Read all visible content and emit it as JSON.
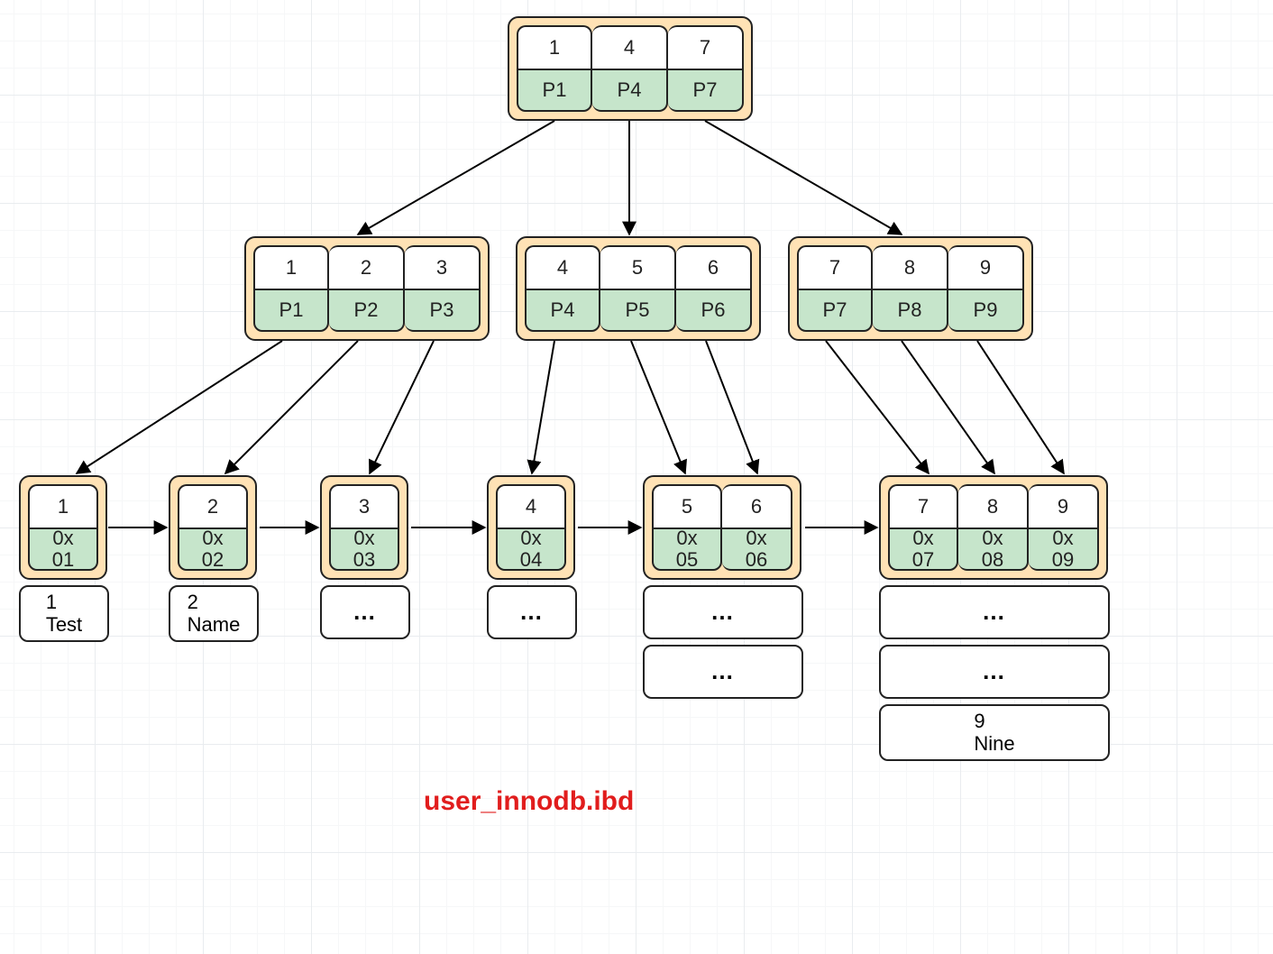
{
  "caption": "user_innodb.ibd",
  "root": {
    "cols": [
      {
        "key": "1",
        "ptr": "P1"
      },
      {
        "key": "4",
        "ptr": "P4"
      },
      {
        "key": "7",
        "ptr": "P7"
      }
    ]
  },
  "mids": [
    {
      "cols": [
        {
          "key": "1",
          "ptr": "P1"
        },
        {
          "key": "2",
          "ptr": "P2"
        },
        {
          "key": "3",
          "ptr": "P3"
        }
      ]
    },
    {
      "cols": [
        {
          "key": "4",
          "ptr": "P4"
        },
        {
          "key": "5",
          "ptr": "P5"
        },
        {
          "key": "6",
          "ptr": "P6"
        }
      ]
    },
    {
      "cols": [
        {
          "key": "7",
          "ptr": "P7"
        },
        {
          "key": "8",
          "ptr": "P8"
        },
        {
          "key": "9",
          "ptr": "P9"
        }
      ]
    }
  ],
  "leaves": [
    {
      "wrap_w": 100,
      "cols": [
        {
          "key": "1",
          "val": "0x\n01"
        }
      ],
      "rows": [
        {
          "text": "1\nTest"
        }
      ]
    },
    {
      "wrap_w": 100,
      "cols": [
        {
          "key": "2",
          "val": "0x\n02"
        }
      ],
      "rows": [
        {
          "text": "2\nName"
        }
      ]
    },
    {
      "wrap_w": 100,
      "cols": [
        {
          "key": "3",
          "val": "0x\n03"
        }
      ],
      "rows": [
        {
          "text": "…",
          "ell": true
        }
      ]
    },
    {
      "wrap_w": 100,
      "cols": [
        {
          "key": "4",
          "val": "0x\n04"
        }
      ],
      "rows": [
        {
          "text": "…",
          "ell": true
        }
      ]
    },
    {
      "wrap_w": 178,
      "cols": [
        {
          "key": "5",
          "val": "0x\n05"
        },
        {
          "key": "6",
          "val": "0x\n06"
        }
      ],
      "rows": [
        {
          "text": "…",
          "ell": true
        },
        {
          "text": "…",
          "ell": true
        }
      ]
    },
    {
      "wrap_w": 256,
      "cols": [
        {
          "key": "7",
          "val": "0x\n07"
        },
        {
          "key": "8",
          "val": "0x\n08"
        },
        {
          "key": "9",
          "val": "0x\n09"
        }
      ],
      "rows": [
        {
          "text": "…",
          "ell": true
        },
        {
          "text": "…",
          "ell": true
        },
        {
          "text": "9\nNine"
        }
      ]
    }
  ]
}
